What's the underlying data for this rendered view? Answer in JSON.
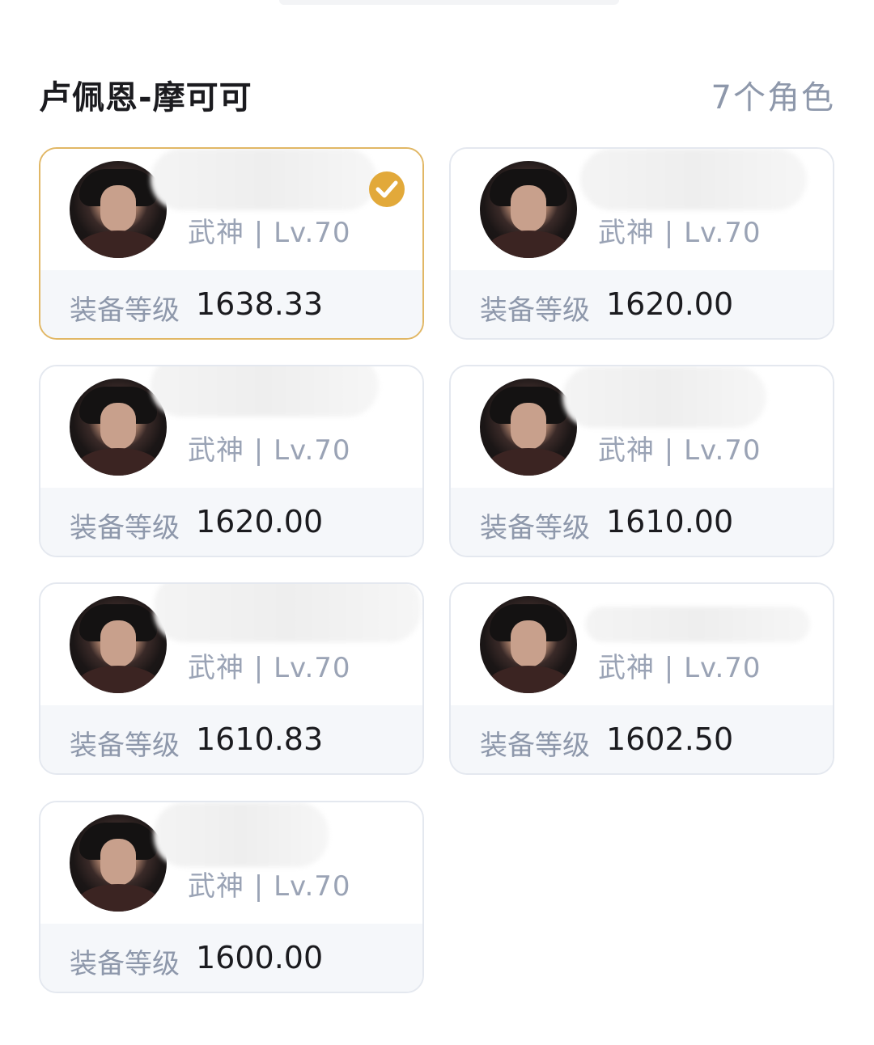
{
  "header": {
    "server_title": "卢佩恩-摩可可",
    "character_count": "7个角色"
  },
  "colors": {
    "selected_border": "#e1b765",
    "check_badge": "#e2a93a",
    "muted_text": "#8e98ab"
  },
  "characters": [
    {
      "class_level": "武神 | Lv.70",
      "gear_label": "装备等级",
      "gear_score": "1638.33",
      "selected": true
    },
    {
      "class_level": "武神 | Lv.70",
      "gear_label": "装备等级",
      "gear_score": "1620.00",
      "selected": false
    },
    {
      "class_level": "武神 | Lv.70",
      "gear_label": "装备等级",
      "gear_score": "1620.00",
      "selected": false
    },
    {
      "class_level": "武神 | Lv.70",
      "gear_label": "装备等级",
      "gear_score": "1610.00",
      "selected": false
    },
    {
      "class_level": "武神 | Lv.70",
      "gear_label": "装备等级",
      "gear_score": "1610.83",
      "selected": false
    },
    {
      "class_level": "武神 | Lv.70",
      "gear_label": "装备等级",
      "gear_score": "1602.50",
      "selected": false
    },
    {
      "class_level": "武神 | Lv.70",
      "gear_label": "装备等级",
      "gear_score": "1600.00",
      "selected": false
    }
  ]
}
